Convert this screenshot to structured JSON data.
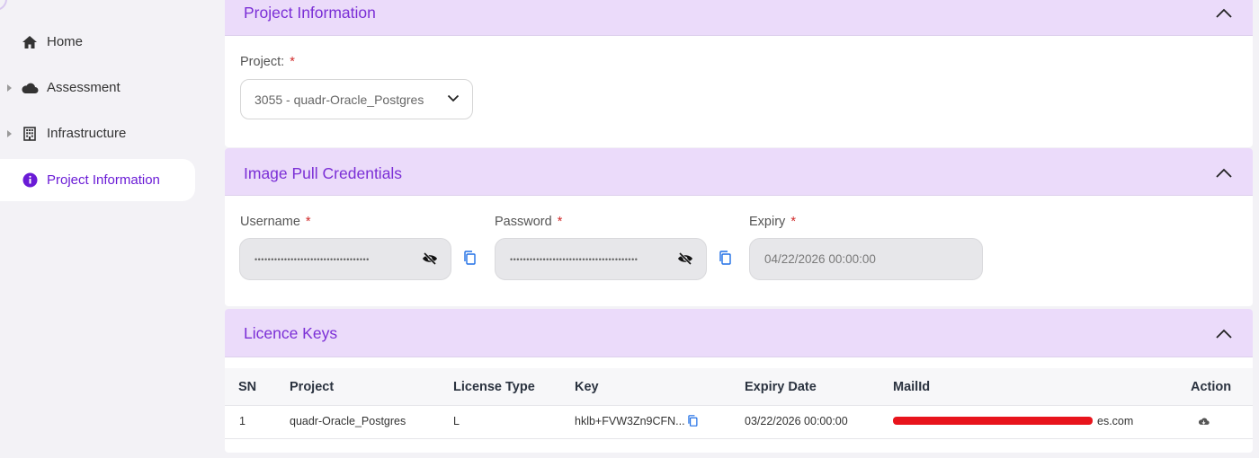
{
  "sidebar": {
    "items": [
      {
        "label": "Home",
        "icon": "home-icon",
        "active": false
      },
      {
        "label": "Assessment",
        "icon": "cloud-icon",
        "active": false
      },
      {
        "label": "Infrastructure",
        "icon": "building-icon",
        "active": false
      },
      {
        "label": "Project Information",
        "icon": "info-icon",
        "active": true
      }
    ]
  },
  "colors": {
    "accent": "#7b2fd6",
    "header_bg": "#ebdbfa",
    "copy_icon": "#1f6fe5",
    "required": "#d12b2b"
  },
  "project_section": {
    "title": "Project Information",
    "project_label": "Project:",
    "project_required": "*",
    "project_value": "3055 - quadr-Oracle_Postgres"
  },
  "credentials_section": {
    "title": "Image Pull Credentials",
    "username_label": "Username",
    "username_value": "•••••••••••••••••••••••••••••••••••",
    "password_label": "Password",
    "password_value": "•••••••••••••••••••••••••••••••••••••••",
    "expiry_label": "Expiry",
    "expiry_value": "04/22/2026 00:00:00",
    "required": "*"
  },
  "licence_section": {
    "title": "Licence Keys",
    "columns": [
      "SN",
      "Project",
      "License Type",
      "Key",
      "Expiry Date",
      "MailId",
      "Action"
    ],
    "rows": [
      {
        "sn": "1",
        "project": "quadr-Oracle_Postgres",
        "license_type": "L",
        "key": "hklb+FVW3Zn9CFN...",
        "expiry_date": "03/22/2026 00:00:00",
        "mail_suffix": "es.com",
        "action_icon": "cloud-download-icon"
      }
    ]
  }
}
